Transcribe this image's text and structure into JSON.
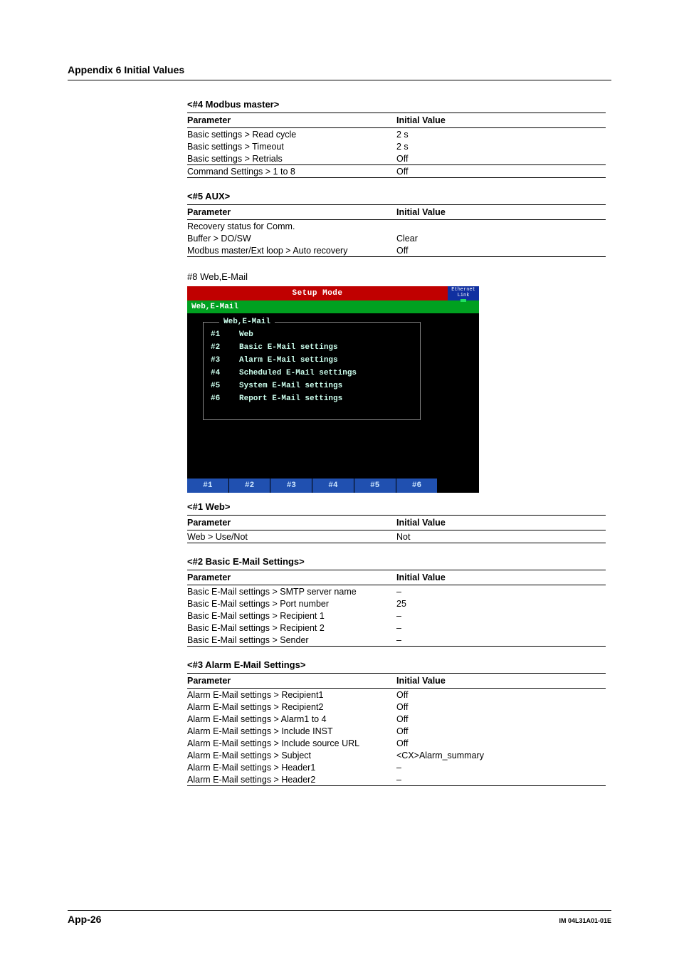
{
  "header": {
    "title": "Appendix 6  Initial Values"
  },
  "sections": {
    "modbus": {
      "title": "<#4 Modbus master>",
      "th_param": "Parameter",
      "th_val": "Initial Value",
      "g1r1p": "Basic settings > Read cycle",
      "g1r1v": "2 s",
      "g1r2p": "Basic settings > Timeout",
      "g1r2v": "2 s",
      "g1r3p": "Basic settings > Retrials",
      "g1r3v": "Off",
      "g2r1p": "Command Settings > 1 to 8",
      "g2r1v": "Off"
    },
    "aux": {
      "title": "<#5 AUX>",
      "th_param": "Parameter",
      "th_val": "Initial Value",
      "r1p": "Recovery status for Comm.",
      "r1v": "",
      "r2p": "Buffer > DO/SW",
      "r2v": "Clear",
      "r3p": "Modbus master/Ext loop > Auto recovery",
      "r3v": "Off"
    },
    "webmail_heading": "#8 Web,E-Mail",
    "screen": {
      "topTitle": "Setup Mode",
      "ethernet": "Ethernet",
      "link": "Link",
      "subTitle": "Web,E-Mail",
      "panelTitle": "Web,E-Mail",
      "items": {
        "n1": "#1",
        "l1": "Web",
        "n2": "#2",
        "l2": "Basic E-Mail settings",
        "n3": "#3",
        "l3": "Alarm E-Mail settings",
        "n4": "#4",
        "l4": "Scheduled E-Mail settings",
        "n5": "#5",
        "l5": "System E-Mail settings",
        "n6": "#6",
        "l6": "Report E-Mail settings"
      },
      "btn1": "#1",
      "btn2": "#2",
      "btn3": "#3",
      "btn4": "#4",
      "btn5": "#5",
      "btn6": "#6"
    },
    "web": {
      "title": "<#1 Web>",
      "th_param": "Parameter",
      "th_val": "Initial Value",
      "r1p": "Web > Use/Not",
      "r1v": "Not"
    },
    "basicEmail": {
      "title": "<#2 Basic E-Mail Settings>",
      "th_param": "Parameter",
      "th_val": "Initial Value",
      "r1p": "Basic E-Mail settings > SMTP server name",
      "r1v": "–",
      "r2p": "Basic E-Mail settings > Port number",
      "r2v": "25",
      "r3p": "Basic E-Mail settings > Recipient 1",
      "r3v": "–",
      "r4p": "Basic E-Mail settings > Recipient 2",
      "r4v": "–",
      "r5p": "Basic E-Mail settings > Sender",
      "r5v": "–"
    },
    "alarmEmail": {
      "title": "<#3 Alarm E-Mail Settings>",
      "th_param": "Parameter",
      "th_val": "Initial Value",
      "r1p": "Alarm E-Mail settings > Recipient1",
      "r1v": "Off",
      "r2p": "Alarm E-Mail settings > Recipient2",
      "r2v": "Off",
      "r3p": "Alarm E-Mail settings > Alarm1 to 4",
      "r3v": "Off",
      "r4p": "Alarm E-Mail settings > Include INST",
      "r4v": "Off",
      "r5p": "Alarm E-Mail settings > Include source URL",
      "r5v": "Off",
      "r6p": "Alarm E-Mail settings > Subject",
      "r6v": "<CX>Alarm_summary",
      "r7p": "Alarm E-Mail settings > Header1",
      "r7v": "–",
      "r8p": "Alarm E-Mail settings > Header2",
      "r8v": "–"
    }
  },
  "footer": {
    "left": "App-26",
    "right": "IM 04L31A01-01E"
  }
}
